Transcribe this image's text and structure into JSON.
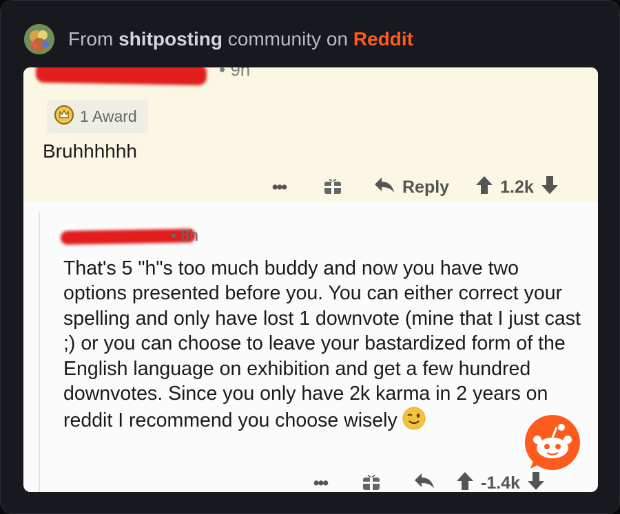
{
  "header": {
    "prefix": "From ",
    "community": "shitposting",
    "middle": " community on ",
    "brand": "Reddit",
    "brand_color": "#ff5b1f"
  },
  "screenshot": {
    "top_comment": {
      "time": "• 9h",
      "award_label": "1 Award",
      "text": "Bruhhhhhh",
      "actions": {
        "more": "•••",
        "reply_label": "Reply",
        "score": "1.2k"
      }
    },
    "reply_comment": {
      "time": "• 8h",
      "text": "That's 5 \"h\"s too much buddy and now you have two options presented before you. You can either correct your spelling and only have lost 1 downvote (mine that I just cast ;) or you can choose to leave your bastardized form of the English language on exhibition and get a few hundred downvotes. Since you only have 2k karma in 2 years on reddit I recommend you choose wisely",
      "emoji": "winking-face",
      "actions": {
        "more": "•••",
        "score": "-1.4k"
      }
    },
    "highlight_color": "#fbf7e4",
    "redaction_color": "#e11d1d"
  },
  "icons": [
    "award-icon",
    "gift-icon",
    "reply-icon",
    "upvote-icon",
    "downvote-icon",
    "reddit-logo-icon"
  ]
}
